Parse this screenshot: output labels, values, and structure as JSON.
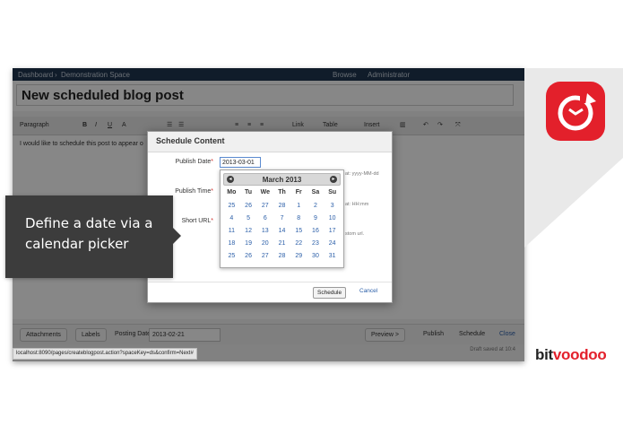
{
  "nav": {
    "crumb1": "Dashboard",
    "crumb2": "Demonstration Space",
    "browse": "Browse",
    "admin": "Administrator"
  },
  "page": {
    "title": "New scheduled blog post"
  },
  "toolbar": {
    "paragraph": "Paragraph",
    "bold": "B",
    "italic": "I",
    "underline": "U",
    "textcolor": "A",
    "link": "Link",
    "table": "Table",
    "insert": "Insert"
  },
  "editor": {
    "text": "I would like to schedule this post to appear o"
  },
  "dialog": {
    "title": "Schedule Content",
    "publish_date_label": "Publish Date",
    "publish_date_value": "2013-03-01",
    "publish_date_hint": "at: yyyy-MM-dd",
    "publish_time_label": "Publish Time",
    "publish_time_hint": "at: HH:mm",
    "short_url_label": "Short URL",
    "short_url_hint": "stom url.",
    "required_mark": "*",
    "schedule_button": "Schedule",
    "cancel_link": "Cancel"
  },
  "calendar": {
    "month_label": "March 2013",
    "prev": "◂",
    "next": "▸",
    "days_of_week": [
      "Mo",
      "Tu",
      "We",
      "Th",
      "Fr",
      "Sa",
      "Su"
    ],
    "weeks": [
      [
        "25",
        "26",
        "27",
        "28",
        "1",
        "2",
        "3"
      ],
      [
        "4",
        "5",
        "6",
        "7",
        "8",
        "9",
        "10"
      ],
      [
        "11",
        "12",
        "13",
        "14",
        "15",
        "16",
        "17"
      ],
      [
        "18",
        "19",
        "20",
        "21",
        "22",
        "23",
        "24"
      ],
      [
        "25",
        "26",
        "27",
        "28",
        "29",
        "30",
        "31"
      ]
    ]
  },
  "bottombar": {
    "attachments": "Attachments",
    "labels": "Labels",
    "posting_date_label": "Posting Date:",
    "posting_date_value": "2013-02-21",
    "preview": "Preview >",
    "publish": "Publish",
    "schedule": "Schedule",
    "close": "Close",
    "draft": "Draft saved at 10:4"
  },
  "statusbar": {
    "url": "localhost:8090/pages/createblogpost.action?spaceKey=ds&confirm=Next#"
  },
  "callout": {
    "line1": "Define a date via a",
    "line2": "calendar picker"
  },
  "logo": {
    "part1": "bit",
    "part2": "voodoo"
  },
  "colors": {
    "accent_red": "#e3202b",
    "brand_dark": "#222222",
    "link_blue": "#2a5ea8",
    "callout_bg": "#3c3c3c"
  },
  "icons": {
    "app_logo": "clock-refresh-icon"
  }
}
